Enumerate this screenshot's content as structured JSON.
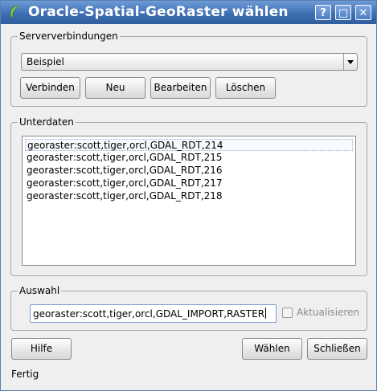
{
  "window": {
    "title": "Oracle-Spatial-GeoRaster wählen",
    "title_icon": "qgis-leaf-icon",
    "controls": {
      "help": "?",
      "maximize": "□",
      "close": "✕"
    }
  },
  "server_connections": {
    "group_label": "Serververbindungen",
    "selected_connection": "Beispiel",
    "buttons": {
      "connect": "Verbinden",
      "new": "Neu",
      "edit": "Bearbeiten",
      "delete": "Löschen"
    }
  },
  "subdata": {
    "group_label": "Unterdaten",
    "items": [
      "georaster:scott,tiger,orcl,GDAL_RDT,214",
      "georaster:scott,tiger,orcl,GDAL_RDT,215",
      "georaster:scott,tiger,orcl,GDAL_RDT,216",
      "georaster:scott,tiger,orcl,GDAL_RDT,217",
      "georaster:scott,tiger,orcl,GDAL_RDT,218"
    ]
  },
  "selection": {
    "group_label": "Auswahl",
    "value": "georaster:scott,tiger,orcl,GDAL_IMPORT,RASTER",
    "refresh_label": "Aktualisieren",
    "refresh_checked": false
  },
  "footer": {
    "help": "Hilfe",
    "select": "Wählen",
    "close": "Schließen",
    "status": "Fertig"
  }
}
